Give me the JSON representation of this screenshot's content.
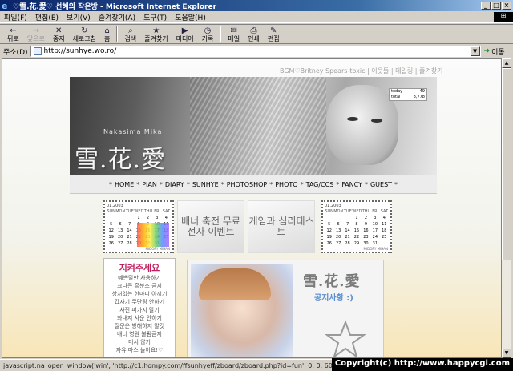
{
  "window": {
    "title": "♡雪.花.愛♡ 선혜의 작은방 - Microsoft Internet Explorer",
    "controls": [
      "_",
      "□",
      "×"
    ]
  },
  "menu": [
    "파일(F)",
    "편집(E)",
    "보기(V)",
    "즐겨찾기(A)",
    "도구(T)",
    "도움말(H)"
  ],
  "toolbar": [
    {
      "label": "뒤로",
      "icon": "←"
    },
    {
      "label": "앞으로",
      "icon": "→"
    },
    {
      "label": "중지",
      "icon": "✕"
    },
    {
      "label": "새로고침",
      "icon": "↻"
    },
    {
      "label": "홈",
      "icon": "⌂"
    },
    {
      "label": "검색",
      "icon": "⌕"
    },
    {
      "label": "즐겨찾기",
      "icon": "★"
    },
    {
      "label": "미디어",
      "icon": "▶"
    },
    {
      "label": "기록",
      "icon": "◷"
    },
    {
      "label": "메일",
      "icon": "✉"
    },
    {
      "label": "인쇄",
      "icon": "⎙"
    },
    {
      "label": "편집",
      "icon": "✎"
    }
  ],
  "address": {
    "label": "주소(D)",
    "url": "http://sunhye.wo.ro/",
    "go": "이동"
  },
  "page": {
    "bgm_line": "BGM♡Britney Spears-toxic | 이웃들 | 메일링 | 즐겨찾기 |",
    "counter": {
      "today_label": "today",
      "today": "49",
      "total_label": "total",
      "total": "8,778"
    },
    "banner_name_small": "Nakasima Mika",
    "banner_name_big": "雪.花.愛",
    "nav": [
      "HOME",
      "PIAN",
      "DIARY",
      "SUNHYE",
      "PHOTOSHOP",
      "PHOTO",
      "TAG/CCS",
      "FANCY",
      "GUEST"
    ],
    "cal_left": {
      "header": "01.2003",
      "days": [
        "SUN",
        "MON",
        "TUE",
        "WED",
        "THU",
        "FRI",
        "SAT"
      ],
      "rows": [
        [
          "",
          "",
          "",
          "1",
          "2",
          "3",
          "4"
        ],
        [
          "5",
          "6",
          "7",
          "8",
          "9",
          "10",
          "11"
        ],
        [
          "12",
          "13",
          "14",
          "15",
          "16",
          "17",
          "18"
        ],
        [
          "19",
          "20",
          "21",
          "22",
          "23",
          "24",
          "25"
        ],
        [
          "26",
          "27",
          "28",
          "29",
          "30",
          "31",
          ""
        ]
      ],
      "footer": "MIDORY  MIHAN"
    },
    "cal_right": {
      "header": "01.2003",
      "days": [
        "SUN",
        "MON",
        "TUE",
        "WED",
        "THU",
        "FRI",
        "SAT"
      ],
      "rows": [
        [
          "",
          "",
          "",
          "1",
          "2",
          "3",
          "4"
        ],
        [
          "5",
          "6",
          "7",
          "8",
          "9",
          "10",
          "11"
        ],
        [
          "12",
          "13",
          "14",
          "15",
          "16",
          "17",
          "18"
        ],
        [
          "19",
          "20",
          "21",
          "22",
          "23",
          "24",
          "25"
        ],
        [
          "26",
          "27",
          "28",
          "29",
          "30",
          "31",
          ""
        ]
      ],
      "footer": "MIDORY  MIHAN"
    },
    "btn_banner": "배너 축전 무료전자 이벤트",
    "btn_game": "게임과 심리테스트",
    "left_box": {
      "title": "지켜주세요",
      "lines": [
        "예쁜말만 사용하기",
        "크나큰 흥분소 금지",
        "상처없는 한마디 아끼기",
        "갑자기 무단링 안하기",
        "사진 퍼가지 말기",
        "화내지 사운 안하기",
        "질문은 방해하지 말것",
        "배너 영원 불펌금지",
        "미서 않기",
        "자유 마스 놀이요!♡"
      ]
    },
    "notice": {
      "title": "雪.花.愛",
      "subtitle": "공지사항 :)"
    }
  },
  "status": {
    "text": "javascript:na_open_window('win', 'http://c1.hompy.com/ffsunhyeff/zboard/zboard.php?id=fun', 0, 0, 600, 0, 0, 0,",
    "copyright": "Copyright(c) http://www.happycgi.com"
  }
}
